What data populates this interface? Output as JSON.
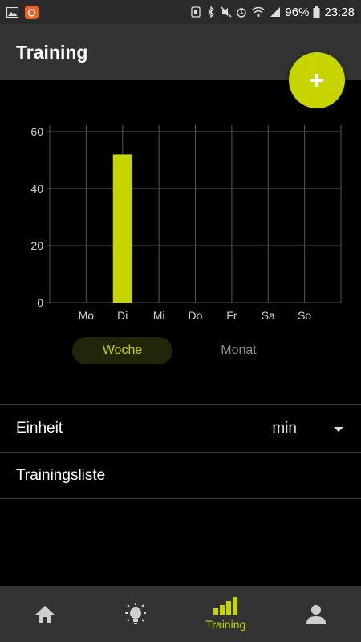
{
  "status_bar": {
    "battery": "96%",
    "time": "23:28",
    "icons": [
      "gallery-icon",
      "app-notification-icon",
      "sim-icon",
      "bluetooth-icon",
      "mute-icon",
      "alarm-icon",
      "wifi-icon",
      "signal-icon",
      "battery-icon"
    ]
  },
  "app_bar": {
    "title": "Training"
  },
  "fab": {
    "label": "+",
    "icon": "plus-icon",
    "color": "#c8d400"
  },
  "chart_data": {
    "type": "bar",
    "categories": [
      "Mo",
      "Di",
      "Mi",
      "Do",
      "Fr",
      "Sa",
      "So"
    ],
    "values": [
      0,
      52,
      0,
      0,
      0,
      0,
      0
    ],
    "yticks": [
      0,
      20,
      40,
      60
    ],
    "ylim": [
      0,
      60
    ],
    "grid": true,
    "bar_color": "#c8d400"
  },
  "toggle": {
    "week": "Woche",
    "month": "Monat",
    "selected": "week"
  },
  "settings": {
    "unit_label": "Einheit",
    "unit_value": "min",
    "training_list_label": "Trainingsliste"
  },
  "bottom_nav": {
    "items": [
      {
        "icon": "home-icon",
        "label": ""
      },
      {
        "icon": "lightbulb-icon",
        "label": ""
      },
      {
        "icon": "training-bars-icon",
        "label": "Training",
        "active": true
      },
      {
        "icon": "profile-icon",
        "label": ""
      }
    ],
    "accent": "#c8d400"
  }
}
